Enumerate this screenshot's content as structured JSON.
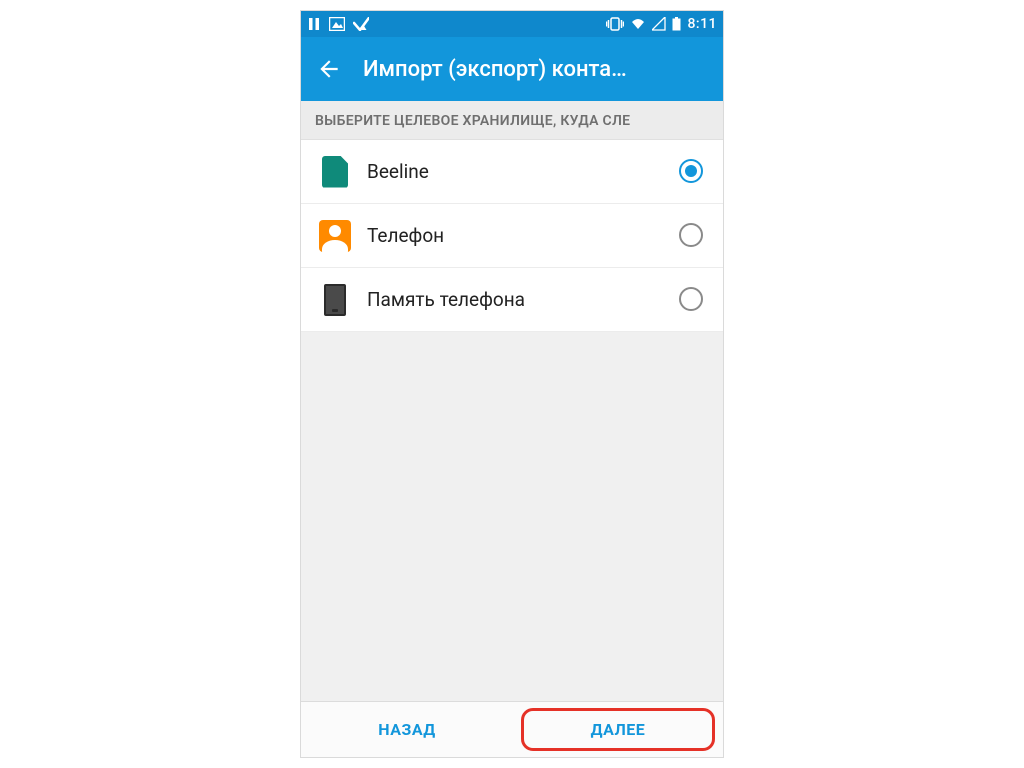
{
  "status": {
    "time": "8:11"
  },
  "header": {
    "title": "Импорт (экспорт) конта…"
  },
  "subheader": "ВЫБЕРИТЕ ЦЕЛЕВОЕ ХРАНИЛИЩЕ, КУДА СЛЕ",
  "options": {
    "0": {
      "label": "Beeline"
    },
    "1": {
      "label": "Телефон"
    },
    "2": {
      "label": "Память телефона"
    }
  },
  "selected_index": 0,
  "buttons": {
    "back": "НАЗАД",
    "next": "ДАЛЕЕ"
  }
}
